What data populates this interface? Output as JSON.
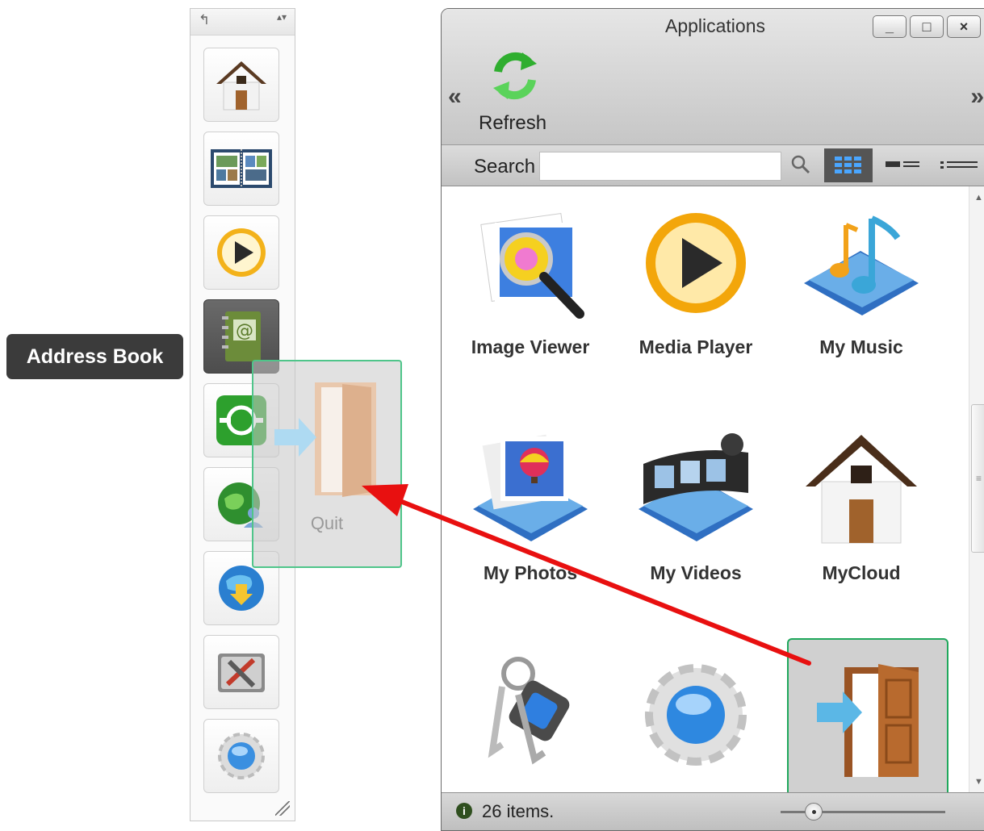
{
  "tooltip": {
    "label": "Address Book"
  },
  "dock": {
    "back_glyph": "↰",
    "sort_glyph": "▴▾",
    "items": [
      {
        "name": "home",
        "icon": "house-icon"
      },
      {
        "name": "photo-album",
        "icon": "photo-album-icon"
      },
      {
        "name": "media-player",
        "icon": "play-icon"
      },
      {
        "name": "address-book",
        "icon": "address-book-icon",
        "active": true
      },
      {
        "name": "sync",
        "icon": "sync-icon"
      },
      {
        "name": "network-user",
        "icon": "globe-user-icon"
      },
      {
        "name": "download",
        "icon": "globe-download-icon"
      },
      {
        "name": "tools",
        "icon": "tools-icon"
      },
      {
        "name": "settings",
        "icon": "gear-icon"
      }
    ]
  },
  "window": {
    "title": "Applications",
    "buttons": {
      "minimize": "_",
      "maximize": "□",
      "close": "×"
    },
    "nav_left": "«",
    "nav_right": "»",
    "toolbar": {
      "refresh_label": "Refresh"
    },
    "search": {
      "label": "Search",
      "value": "",
      "placeholder": ""
    },
    "apps": [
      {
        "label": "Image Viewer",
        "icon": "image-viewer-icon"
      },
      {
        "label": "Media Player",
        "icon": "media-player-icon"
      },
      {
        "label": "My Music",
        "icon": "music-icon"
      },
      {
        "label": "My Photos",
        "icon": "photos-icon"
      },
      {
        "label": "My Videos",
        "icon": "videos-icon"
      },
      {
        "label": "MyCloud",
        "icon": "house-icon"
      },
      {
        "label": "",
        "icon": "keys-icon"
      },
      {
        "label": "",
        "icon": "gear-icon"
      },
      {
        "label": "",
        "icon": "quit-door-icon",
        "selected": true
      }
    ],
    "status": {
      "info_glyph": "i",
      "text": "26 items."
    },
    "zoom_level": 0.2
  },
  "drag_ghost": {
    "label": "Quit"
  },
  "colors": {
    "selection": "#1fa85c",
    "arrow": "#e81010",
    "tooltip_bg": "#3b3b3b",
    "door": "#b86a2e",
    "door_arrow": "#5bb7e6"
  }
}
